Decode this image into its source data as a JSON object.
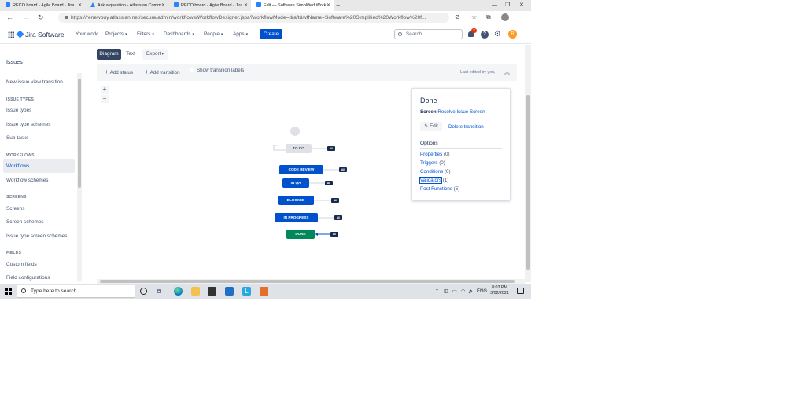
{
  "browser": {
    "tabs": [
      {
        "label": "RECO board - Agile Board - Jira",
        "active": false
      },
      {
        "label": "Ask a question - Atlassian Comm",
        "active": false
      },
      {
        "label": "RECO board - Agile Board - Jira",
        "active": false
      },
      {
        "label": "Edit — Software Simplified Work",
        "active": true
      }
    ],
    "new_tab": "+",
    "url": "https://renewbuy.atlassian.net/secure/admin/workflows/WorkflowDesigner.jspa?workflowMode=draft&wfName=Software%20Simplified%20Workflow%20f..."
  },
  "topnav": {
    "product": "Jira Software",
    "items": [
      {
        "label": "Your work",
        "dropdown": false
      },
      {
        "label": "Projects",
        "dropdown": true
      },
      {
        "label": "Filters",
        "dropdown": true
      },
      {
        "label": "Dashboards",
        "dropdown": true
      },
      {
        "label": "People",
        "dropdown": true
      },
      {
        "label": "Apps",
        "dropdown": true
      }
    ],
    "create_label": "Create",
    "search_placeholder": "Search",
    "notification_count": "2",
    "help_glyph": "?",
    "gear_glyph": "⚙",
    "avatar_initial": "R"
  },
  "sidebar": {
    "title": "Issues",
    "top_link": "New issue view transition",
    "sections": [
      {
        "heading": "ISSUE TYPES",
        "items": [
          "Issue types",
          "Issue type schemes",
          "Sub-tasks"
        ]
      },
      {
        "heading": "WORKFLOWS",
        "items": [
          "Workflows",
          "Workflow schemes"
        ]
      },
      {
        "heading": "SCREENS",
        "items": [
          "Screens",
          "Screen schemes",
          "Issue type screen schemes"
        ]
      },
      {
        "heading": "FIELDS",
        "items": [
          "Custom fields",
          "Field configurations"
        ]
      }
    ],
    "active_item": "Workflows"
  },
  "view_tabs": {
    "diagram": "Diagram",
    "text": "Text",
    "export": "Export"
  },
  "toolbar": {
    "add_status": "Add status",
    "add_transition": "Add transition",
    "show_labels": "Show transition labels",
    "last_edited": "Last edited by you,"
  },
  "zoom": {
    "in": "+",
    "out": "−"
  },
  "diagram": {
    "all_tag": "All",
    "statuses": [
      {
        "label": "TO DO",
        "category": "todo"
      },
      {
        "label": "CODE REVIEW",
        "category": "in-progress"
      },
      {
        "label": "IN QA",
        "category": "in-progress"
      },
      {
        "label": "BLOCKED",
        "category": "in-progress"
      },
      {
        "label": "IN PROGRESS",
        "category": "in-progress"
      },
      {
        "label": "DONE",
        "category": "done"
      }
    ]
  },
  "detail_panel": {
    "title": "Done",
    "screen_label": "Screen",
    "screen_value": "Resolve Issue Screen",
    "edit_label": "Edit",
    "delete_label": "Delete transition",
    "options_heading": "Options",
    "options": [
      {
        "name": "Properties",
        "count": "(0)"
      },
      {
        "name": "Triggers",
        "count": "(0)"
      },
      {
        "name": "Conditions",
        "count": "(0)"
      },
      {
        "name": "Validators",
        "count": "(1)"
      },
      {
        "name": "Post Functions",
        "count": "(5)"
      }
    ]
  },
  "taskbar": {
    "search_placeholder": "Type here to search",
    "language": "ENG",
    "time": "8:03 PM",
    "date": "3/02/2021"
  },
  "colors": {
    "jira_blue": "#0052cc",
    "status_blue": "#0052cc",
    "status_green": "#00875a",
    "status_grey": "#dfe1e6",
    "dark_tag": "#172b4d"
  }
}
